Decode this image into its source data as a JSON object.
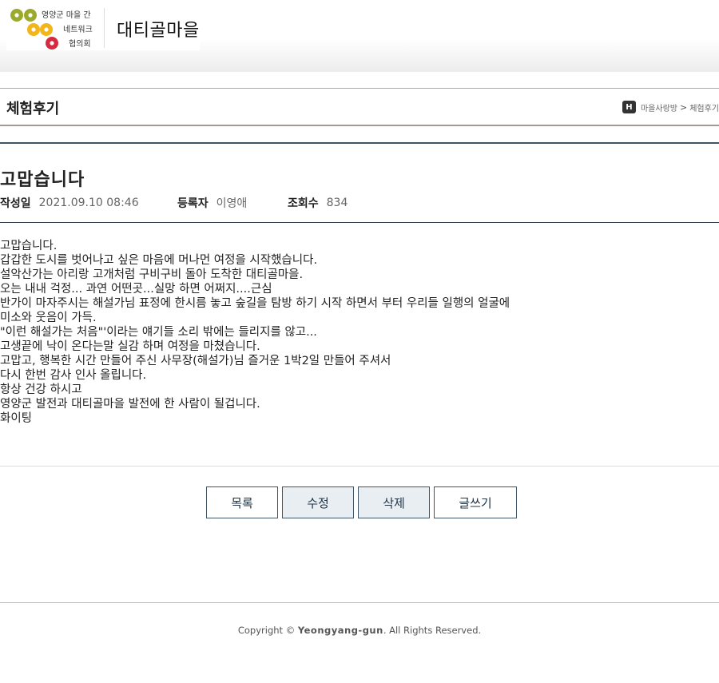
{
  "header": {
    "logo_text_lines": [
      "영양군 마을 간",
      "네트워크",
      "협의회"
    ],
    "village_name": "대티골마을"
  },
  "section": {
    "title": "체험후기",
    "breadcrumb": {
      "home_badge": "H",
      "items": [
        "마을사랑방",
        "체험후기"
      ],
      "separator": ">"
    }
  },
  "post": {
    "title": "고맙습니다",
    "meta": {
      "date_label": "작성일",
      "date_value": "2021.09.10 08:46",
      "author_label": "등록자",
      "author_value": "이영애",
      "views_label": "조회수",
      "views_value": "834"
    },
    "body_lines": [
      "고맙습니다.",
      "갑갑한 도시를 벗어나고 싶은 마음에 머나먼 여정을 시작했습니다.",
      "설악산가는 아리랑 고개처럼 구비구비 돌아 도착한 대티골마을.",
      "오는 내내 걱정... 과연 어떤곳...실망 하면 어쩌지....근심",
      "반가이 마자주시는 해설가님 표정에 한시름 놓고 숲길을 탐방 하기 시작 하면서 부터 우리들 일행의 얼굴에",
      "미소와 웃음이 가득.",
      "\"이런 해설가는 처음\"'이라는 얘기들 소리 밖에는 들리지를 않고...",
      "고생끝에 낙이 온다는말 실감 하며 여정을 마쳤습니다.",
      "고맙고, 행복한 시간 만들어 주신 사무장(해설가)님 즐거운 1박2일 만들어 주셔서",
      "다시 한번 감사 인사 올립니다.",
      "항상 건강 하시고",
      "영양군 발전과 대티골마을 발전에 한 사람이 될겁니다.",
      "화이팅"
    ]
  },
  "buttons": {
    "list": "목록",
    "edit": "수정",
    "delete": "삭제",
    "write": "글쓰기"
  },
  "footer": {
    "copyright_prefix": "Copyright ©",
    "brand": "Yeongyang-gun",
    "copyright_suffix": ". All Rights Reserved."
  },
  "colors": {
    "logo_green": "#9aaa2a",
    "logo_yellow": "#f2b51a",
    "logo_red": "#d62b3f",
    "rule_navy": "#3f5566",
    "button_text": "#1f3345"
  }
}
